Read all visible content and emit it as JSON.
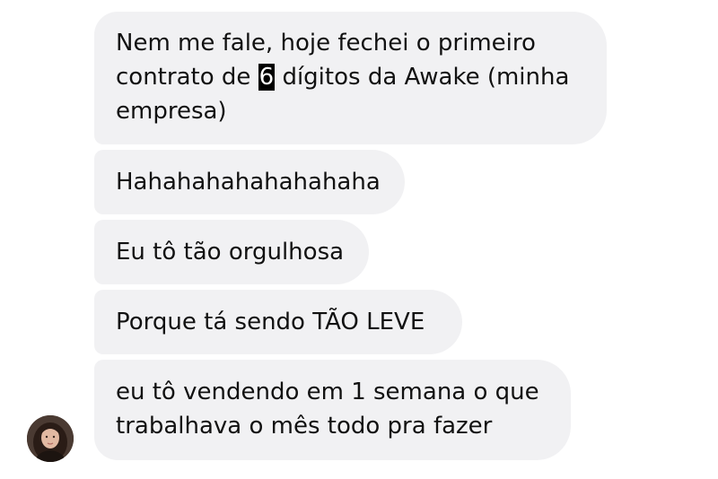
{
  "conversation": {
    "messages": [
      {
        "lines": [
          {
            "before": "Nem me fale, hoje fechei o primeiro"
          },
          {
            "before": "contrato de ",
            "highlight": "6",
            "after": " dígitos da Awake (minha"
          },
          {
            "before": "empresa)"
          }
        ]
      },
      {
        "lines": [
          {
            "before": "Hahahahahahahahaha"
          }
        ]
      },
      {
        "lines": [
          {
            "before": "Eu tô tão orgulhosa"
          }
        ]
      },
      {
        "lines": [
          {
            "before": "Porque tá sendo TÃO LEVE"
          }
        ]
      },
      {
        "lines": [
          {
            "before": "eu tô vendendo em 1 semana o que"
          },
          {
            "before": "trabalhava o mês todo pra fazer"
          }
        ]
      }
    ],
    "sender_avatar_icon": "user-avatar"
  },
  "colors": {
    "bubble_background": "#f1f1f3",
    "text": "#111111",
    "highlight_background": "#000000",
    "highlight_text": "#ffffff"
  }
}
